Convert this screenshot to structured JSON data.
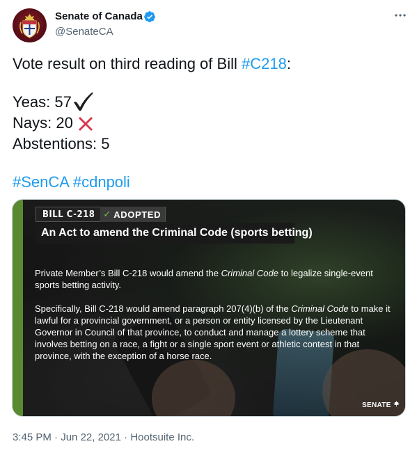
{
  "author": {
    "name": "Senate of Canada",
    "handle": "@SenateCA",
    "verified": true
  },
  "tweet": {
    "intro_text": "Vote result on third reading of Bill ",
    "intro_hashtag": "#C218",
    "intro_suffix": ":",
    "yeas": "Yeas: 57",
    "nays": "Nays: 20",
    "abstentions": "Abstentions: 5",
    "hashtag1": "#SenCA",
    "hashtag2": "#cdnpoli",
    "check_icon": "heavy-check-mark",
    "cross_icon": "cross-mark"
  },
  "media": {
    "bill_number": "BILL C-218",
    "status_check": "✓",
    "status_label": "ADOPTED",
    "title": "An Act to amend the Criminal Code (sports betting)",
    "desc1_a": "Private Member’s Bill C-218 would amend the ",
    "desc1_em": "Criminal Code",
    "desc1_b": " to legalize single-event sports betting activity.",
    "desc2_a": "Specifically, Bill C-218 would amend paragraph 207(4)(b) of the ",
    "desc2_em": "Criminal Code",
    "desc2_b": " to make it lawful for a provincial government, or a person or entity licensed by the Lieutenant Governor in Council of that province, to conduct and manage a lottery scheme that involves betting on a race, a fight or a single sport event or athletic contest in that province, with the exception of a horse race.",
    "logo_text": "SENATE",
    "accent_color": "#5a8a2f"
  },
  "meta": {
    "time": "3:45 PM",
    "separator1": " · ",
    "date": "Jun 22, 2021",
    "separator2": " · ",
    "source": "Hootsuite Inc."
  },
  "colors": {
    "link": "#1d9bf0",
    "muted": "#536471",
    "text": "#0f1419",
    "check": "#1f1f1f",
    "cross": "#d9344c"
  }
}
